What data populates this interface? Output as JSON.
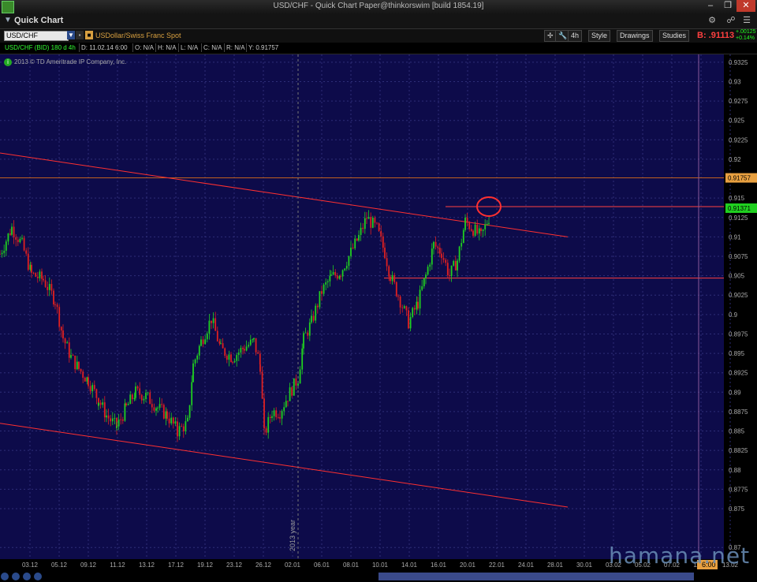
{
  "window": {
    "title": "USD/CHF - Quick Chart Paper@thinkorswim [build 1854.19]"
  },
  "panel": {
    "label": "Quick Chart"
  },
  "toolbar": {
    "symbol": "USD/CHF",
    "description": "USDollar/Swiss Franc Spot",
    "timeframe": "4h",
    "style_label": "Style",
    "drawings_label": "Drawings",
    "studies_label": "Studies",
    "bid": "B: .91113",
    "change": "+.00125",
    "change_pct": "+0.14%"
  },
  "infobar": {
    "study": "USD/CHF (BID) 180 d 4h",
    "date": "D: 11.02.14 6:00",
    "open": "O: N/A",
    "high": "H: N/A",
    "low": "L: N/A",
    "close": "C: N/A",
    "range": "R: N/A",
    "y": "Y: 0.91757"
  },
  "chart": {
    "copyright": "2013 © TD Ameritrade IP Company, Inc."
  },
  "watermark": "hamana.net",
  "chart_data": {
    "type": "line",
    "title": "",
    "xlabel": "",
    "ylabel": "",
    "annotation": "2013 year",
    "x_ticks": [
      "03.12",
      "05.12",
      "09.12",
      "11.12",
      "13.12",
      "17.12",
      "19.12",
      "23.12",
      "26.12",
      "02.01",
      "06.01",
      "08.01",
      "10.01",
      "14.01",
      "16.01",
      "20.01",
      "22.01",
      "24.01",
      "28.01",
      "30.01",
      "03.02",
      "05.02",
      "07.02",
      "11.02",
      "13.02"
    ],
    "y_ticks": [
      "0.9325",
      "0.93",
      "0.9275",
      "0.925",
      "0.9225",
      "0.92",
      "0.915",
      "0.9125",
      "0.91",
      "0.9075",
      "0.905",
      "0.9025",
      "0.9",
      "0.8975",
      "0.895",
      "0.8925",
      "0.89",
      "0.8875",
      "0.885",
      "0.8825",
      "0.88",
      "0.8775",
      "0.875",
      "0.87"
    ],
    "ylim": [
      0.8685,
      0.9335
    ],
    "price_labels": [
      {
        "text": "0.91757",
        "value": 0.9176
      },
      {
        "text": "0.91371",
        "value": 0.9137
      }
    ],
    "time_label": "6:00",
    "horizontal_lines": [
      {
        "value": 0.9176,
        "color": "#c06020"
      },
      {
        "value": 0.9139,
        "color": "#ff4040"
      },
      {
        "value": 0.9047,
        "color": "#ff4040"
      }
    ],
    "trendlines": [
      {
        "from": [
          0,
          0.9208
        ],
        "to": [
          720,
          0.91
        ]
      },
      {
        "from": [
          0,
          0.886
        ],
        "to": [
          720,
          0.8752
        ]
      }
    ],
    "path": [
      [
        0,
        0.9078
      ],
      [
        15,
        0.9112
      ],
      [
        28,
        0.909
      ],
      [
        40,
        0.9052
      ],
      [
        55,
        0.9045
      ],
      [
        70,
        0.9018
      ],
      [
        80,
        0.897
      ],
      [
        90,
        0.8945
      ],
      [
        100,
        0.893
      ],
      [
        112,
        0.8915
      ],
      [
        125,
        0.889
      ],
      [
        135,
        0.887
      ],
      [
        148,
        0.8855
      ],
      [
        160,
        0.888
      ],
      [
        172,
        0.89
      ],
      [
        185,
        0.8895
      ],
      [
        200,
        0.888
      ],
      [
        212,
        0.887
      ],
      [
        225,
        0.885
      ],
      [
        238,
        0.886
      ],
      [
        245,
        0.8935
      ],
      [
        255,
        0.8965
      ],
      [
        268,
        0.8995
      ],
      [
        280,
        0.8955
      ],
      [
        295,
        0.8945
      ],
      [
        310,
        0.8958
      ],
      [
        322,
        0.8965
      ],
      [
        330,
        0.8935
      ],
      [
        335,
        0.8845
      ],
      [
        345,
        0.8875
      ],
      [
        355,
        0.8875
      ],
      [
        365,
        0.8895
      ],
      [
        378,
        0.8918
      ],
      [
        385,
        0.8968
      ],
      [
        395,
        0.899
      ],
      [
        408,
        0.903
      ],
      [
        420,
        0.9048
      ],
      [
        432,
        0.9055
      ],
      [
        445,
        0.908
      ],
      [
        455,
        0.91
      ],
      [
        465,
        0.9125
      ],
      [
        478,
        0.911
      ],
      [
        488,
        0.908
      ],
      [
        495,
        0.905
      ],
      [
        505,
        0.9025
      ],
      [
        518,
        0.899
      ],
      [
        530,
        0.9015
      ],
      [
        540,
        0.905
      ],
      [
        550,
        0.909
      ],
      [
        560,
        0.908
      ],
      [
        570,
        0.905
      ],
      [
        580,
        0.907
      ],
      [
        590,
        0.912
      ],
      [
        600,
        0.911
      ],
      [
        610,
        0.91
      ],
      [
        620,
        0.9125
      ],
      [
        622,
        0.9137
      ]
    ],
    "grid": true,
    "highlight_circle": [
      620,
      0.9139
    ]
  }
}
